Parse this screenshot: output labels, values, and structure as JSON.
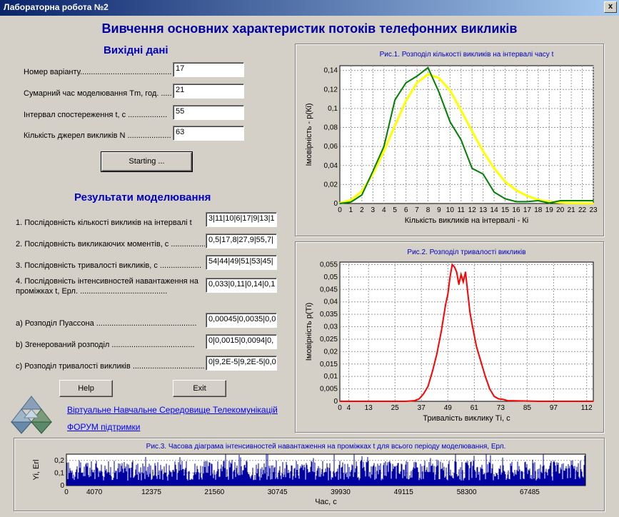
{
  "window": {
    "title": "Лабораторна робота №2",
    "close_label": "x"
  },
  "heading": "Вивчення основних характеристик потоків телефонних викликів",
  "inputs_section": {
    "title": "Вихідні дані",
    "fields": [
      {
        "label": "Номер варіанту.................................................",
        "value": "17"
      },
      {
        "label": "Сумарний час моделювання Tm, год. .......",
        "value": "21"
      },
      {
        "label": "Інтервал спостереження t, с ..................",
        "value": "55"
      },
      {
        "label": "Кількість джерел викликів N ....................",
        "value": "63"
      }
    ],
    "start_label": "Starting ..."
  },
  "results_section": {
    "title": "Результати моделювання",
    "items": [
      {
        "label": "1. Послідовність кількості викликів на інтервалі t",
        "value": "3|11|10|6|17|9|13|1"
      },
      {
        "label": "2. Послідовність викликаючих моментів, с ...................",
        "value": "0,5|17,8|27,9|55,7|"
      },
      {
        "label": "3. Послідовність тривалості викликів, с ...................",
        "value": "54|44|49|51|53|45|"
      },
      {
        "label": "4. Послідовність інтенсивностей навантаження на",
        "label2": "проміжках t, Ерл. ........................................",
        "value": "0,033|0,11|0,14|0,1"
      },
      {
        "label": "а) Розподіл Пуассона ..............................................",
        "value": "0,00045|0,0035|0,0"
      },
      {
        "label": "b) Згенерований розподіл ......................................",
        "value": "0|0,0015|0,0094|0,"
      },
      {
        "label": "c) Розподіл тривалості викликів .................................",
        "value": "0|9,2E-5|9,2E-5|0,0"
      }
    ]
  },
  "buttons": {
    "help": "Help",
    "exit": "Exit"
  },
  "links": {
    "virtual_env": "Віртуальне Навчальне Середовище Телекомунікацій",
    "forum": "ФОРУМ підтримки"
  },
  "colors": {
    "accent": "#0000c0",
    "poisson": "#ffff00",
    "generated": "#008000",
    "duration": "#ff0000",
    "timeline": "#0000a0"
  },
  "chart_data": [
    {
      "type": "line",
      "title": "Рис.1. Розподіл кількості викликів на інтервалі часу t",
      "xlabel": "Кількість викликів на інтервалі - Кі",
      "ylabel": "Імовірність - p(Кі)",
      "xlim": [
        0,
        23
      ],
      "ylim": [
        0,
        0.145
      ],
      "x_ticks": [
        0,
        1,
        2,
        3,
        4,
        5,
        6,
        7,
        8,
        9,
        10,
        11,
        12,
        13,
        14,
        15,
        16,
        17,
        18,
        19,
        20,
        21,
        22,
        23
      ],
      "y_ticks": [
        "0",
        "0,02",
        "0,04",
        "0,06",
        "0,08",
        "0,1",
        "0,12",
        "0,14"
      ],
      "grid": true,
      "series": [
        {
          "color": "#ffff00",
          "x": [
            0,
            1,
            2,
            3,
            4,
            5,
            6,
            7,
            8,
            9,
            10,
            11,
            12,
            13,
            14,
            15,
            16,
            17,
            18,
            19,
            20,
            21,
            22,
            23
          ],
          "values": [
            0.0005,
            0.0035,
            0.013,
            0.031,
            0.055,
            0.082,
            0.108,
            0.127,
            0.136,
            0.132,
            0.119,
            0.098,
            0.076,
            0.055,
            0.037,
            0.023,
            0.014,
            0.008,
            0.004,
            0.002,
            0.001,
            0.0005,
            0.0002,
            0.0001
          ]
        },
        {
          "color": "#008000",
          "x": [
            0,
            1,
            2,
            3,
            4,
            5,
            6,
            7,
            8,
            9,
            10,
            11,
            12,
            13,
            14,
            15,
            16,
            17,
            18,
            19,
            20,
            21,
            22,
            23
          ],
          "values": [
            0,
            0.0015,
            0.009,
            0.034,
            0.06,
            0.109,
            0.127,
            0.134,
            0.143,
            0.117,
            0.086,
            0.067,
            0.037,
            0.031,
            0.012,
            0.005,
            0.002,
            0.002,
            0.003,
            0.0005,
            0.003,
            0.003,
            0.003,
            0.003
          ]
        }
      ]
    },
    {
      "type": "line",
      "title": "Рис.2. Розподіл тривалості викликів",
      "xlabel": "Тривалість виклику Ті, с",
      "ylabel": "Імовірність p(Ті)",
      "xlim": [
        0,
        115
      ],
      "ylim": [
        0,
        0.056
      ],
      "x_ticks": [
        0,
        4,
        13,
        25,
        37,
        49,
        61,
        73,
        85,
        97,
        112
      ],
      "y_ticks": [
        "0",
        "0,005",
        "0,01",
        "0,015",
        "0,02",
        "0,025",
        "0,03",
        "0,035",
        "0,04",
        "0,045",
        "0,05",
        "0,055"
      ],
      "grid": true,
      "series": [
        {
          "color": "#ff0000",
          "x": [
            0,
            30,
            34,
            36,
            38,
            40,
            42,
            44,
            46,
            48,
            49,
            50,
            51,
            52,
            53,
            54,
            55,
            56,
            57,
            58,
            59,
            60,
            62,
            64,
            66,
            68,
            70,
            72,
            74,
            76,
            80,
            85,
            90,
            100,
            115
          ],
          "values": [
            0,
            0,
            0.0003,
            0.001,
            0.003,
            0.006,
            0.012,
            0.019,
            0.028,
            0.039,
            0.043,
            0.05,
            0.055,
            0.054,
            0.052,
            0.047,
            0.051,
            0.048,
            0.052,
            0.044,
            0.036,
            0.031,
            0.022,
            0.016,
            0.01,
            0.005,
            0.002,
            0.001,
            0.0008,
            0.0003,
            0.0002,
            0.0001,
            0,
            0,
            0
          ]
        }
      ]
    },
    {
      "type": "bar",
      "title": "Рис.3. Часова діаграма інтенсивностей навантаження на проміжках t для всього періоду моделювання, Ерл.",
      "xlabel": "Час, с",
      "ylabel": "Yi, Erl",
      "xlim": [
        0,
        75600
      ],
      "ylim": [
        0,
        0.25
      ],
      "x_ticks": [
        0,
        4070,
        12375,
        21560,
        30745,
        39930,
        49115,
        58300,
        67485
      ],
      "y_ticks": [
        "0",
        "0,1",
        "0,2"
      ],
      "grid": true,
      "series": [
        {
          "color": "#0000a0",
          "mean": 0.12,
          "spread": 0.08
        }
      ]
    }
  ]
}
